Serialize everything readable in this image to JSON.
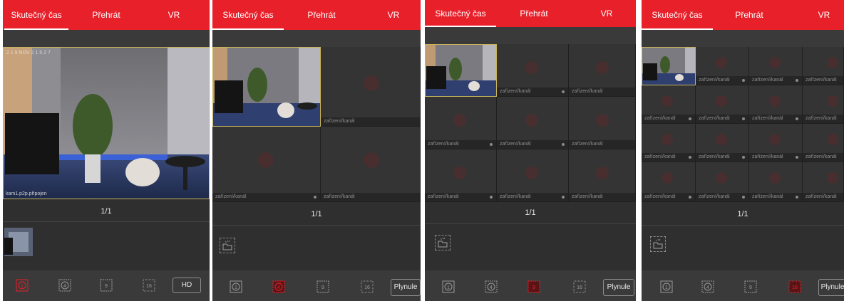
{
  "tabs": {
    "live": "Skutečný čas",
    "playback": "Přehrát",
    "vr": "VR"
  },
  "colors": {
    "accent": "#e8202a",
    "panel_bg": "#2f2f2f",
    "selection": "#c8b45a"
  },
  "channel_label": "zařízení/kanál",
  "panels": [
    {
      "pager": "1/1",
      "camera_caption": "kam1.p2p.připojen",
      "camera_overlay": "2 1 9 NOV 2 1 5 2 7",
      "layout_buttons": [
        "1",
        "4",
        "9",
        "16"
      ],
      "active_layout": "1",
      "quality_button": "HD"
    },
    {
      "pager": "1/1",
      "layout_buttons": [
        "1",
        "4",
        "9",
        "16"
      ],
      "active_layout": "4",
      "smooth_button": "Plynule"
    },
    {
      "pager": "1/1",
      "layout_buttons": [
        "1",
        "4",
        "9",
        "16"
      ],
      "active_layout": "9",
      "smooth_button": "Plynule"
    },
    {
      "pager": "1/1",
      "layout_buttons": [
        "1",
        "4",
        "9",
        "16"
      ],
      "active_layout": "16",
      "smooth_button": "Plynule"
    }
  ]
}
